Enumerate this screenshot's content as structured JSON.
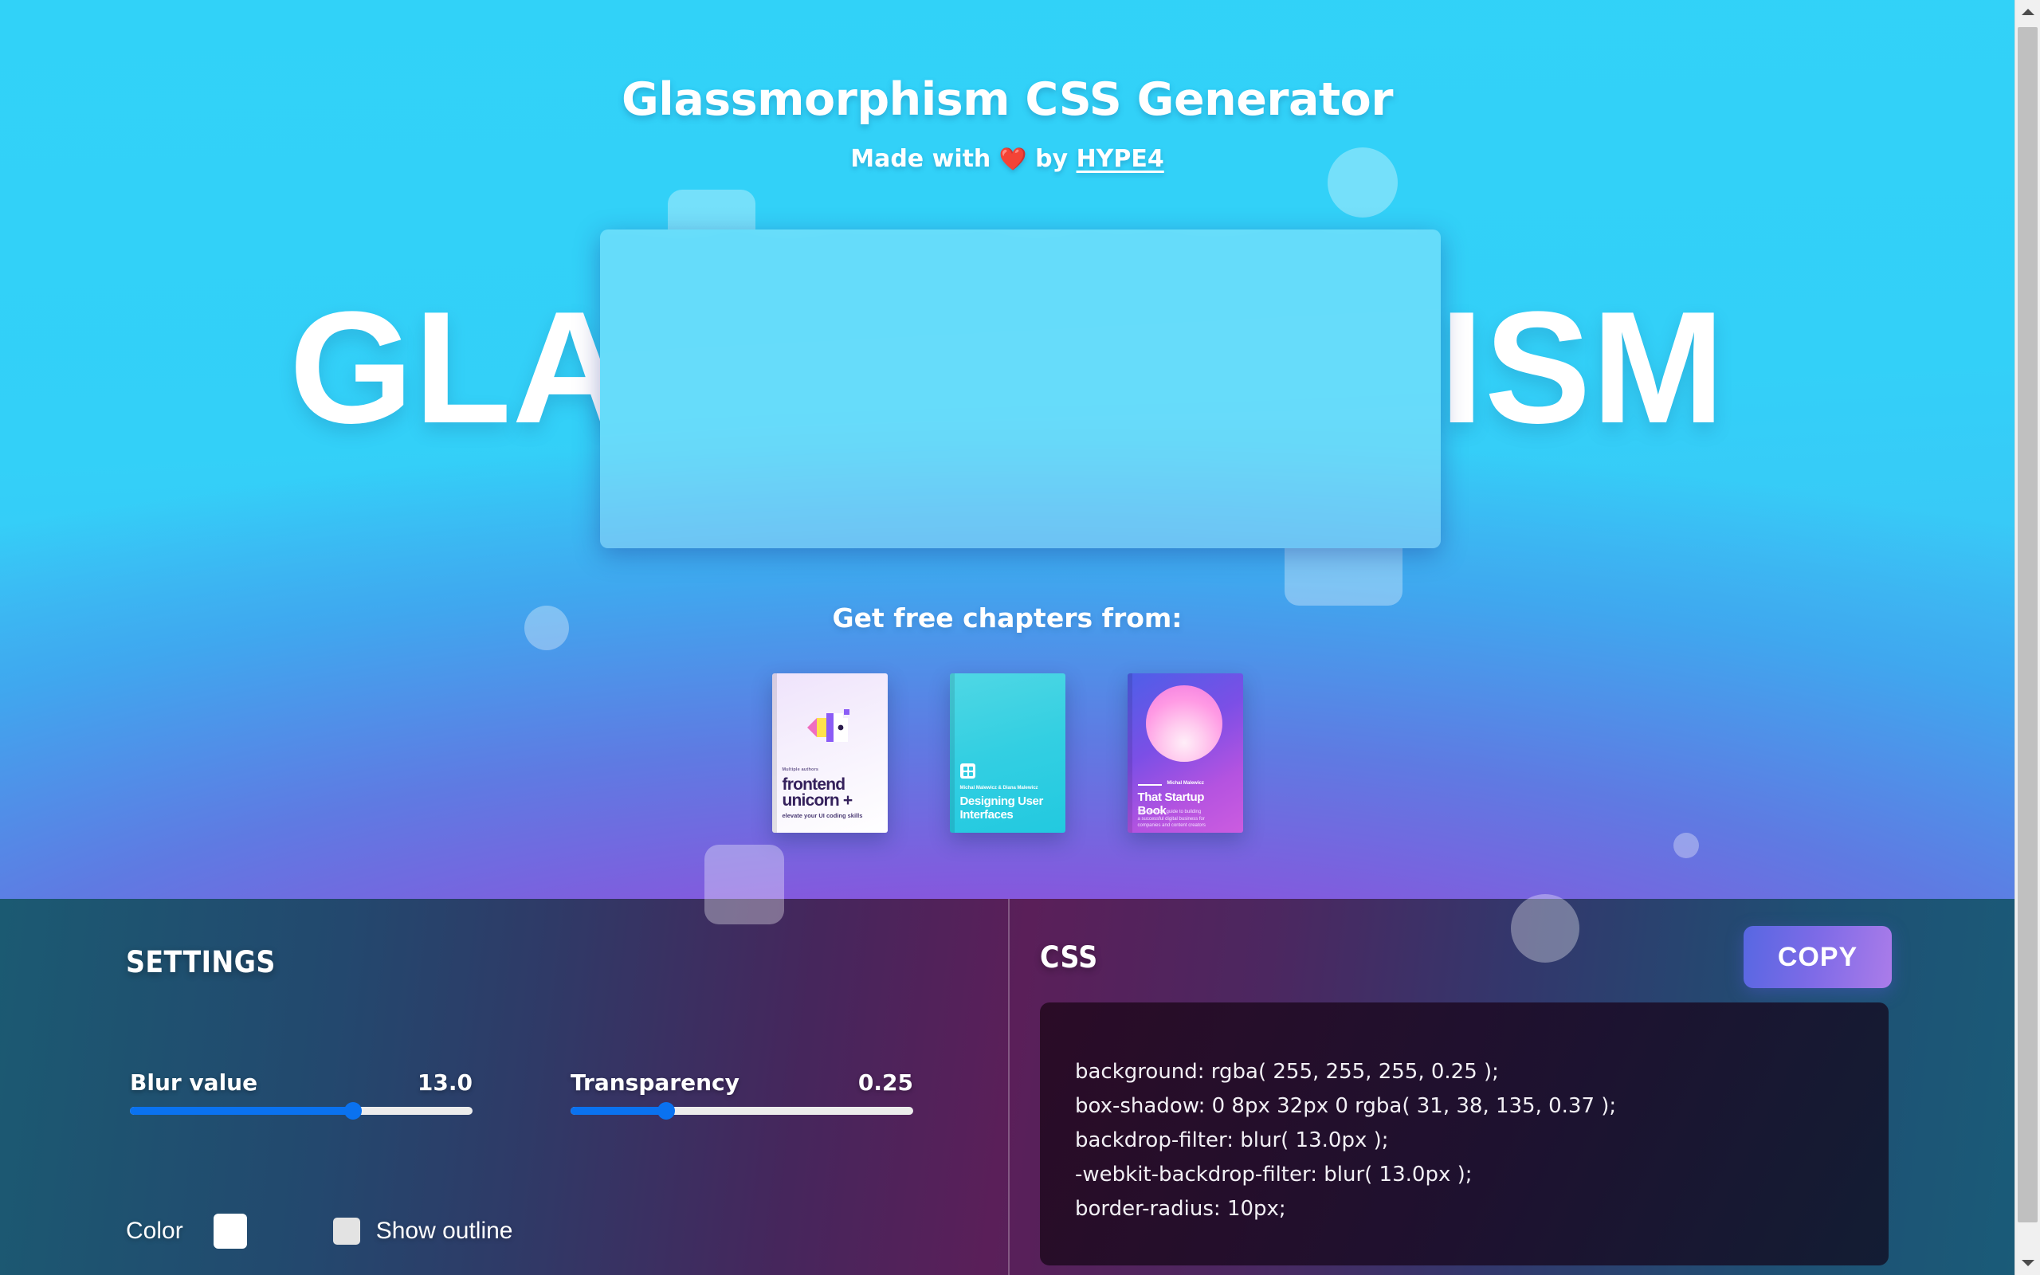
{
  "hero": {
    "title": "Glassmorphism CSS Generator",
    "made_with_prefix": "Made with",
    "heart_icon": "heart-icon",
    "by_text": "by",
    "brand_link": "HYPE4",
    "big_word": "GLASSMORPHISM",
    "chapters_title": "Get free chapters from:"
  },
  "books": [
    {
      "author": "Multiple authors",
      "title_line1": "frontend",
      "title_line2": "unicorn +",
      "tagline": "elevate your UI coding skills"
    },
    {
      "author": "Michal Malewicz & Diana Malewicz",
      "title_line1": "Designing User",
      "title_line2": "Interfaces"
    },
    {
      "author": "Michal Malewicz",
      "title": "That Startup Book",
      "blurb_line1": "The practical guide to building",
      "blurb_line2": "a successful digital business for",
      "blurb_line3": "companies and content creators"
    }
  ],
  "settings": {
    "heading": "SETTINGS",
    "blur": {
      "label": "Blur value",
      "value": "13.0",
      "fill_percent": 65
    },
    "transparency": {
      "label": "Transparency",
      "value": "0.25",
      "fill_percent": 28
    },
    "color": {
      "label": "Color",
      "swatch_hex": "#ffffff"
    },
    "outline": {
      "label": "Show outline",
      "checked": false
    }
  },
  "css_panel": {
    "heading": "CSS",
    "copy_label": "COPY",
    "lines": [
      "background: rgba( 255, 255, 255, 0.25 );",
      "box-shadow: 0 8px 32px 0 rgba( 31, 38, 135, 0.37 );",
      "backdrop-filter: blur( 13.0px );",
      "-webkit-backdrop-filter: blur( 13.0px );",
      "border-radius: 10px;"
    ]
  },
  "colors": {
    "hero_top": "#31d2f8",
    "hero_purple": "#a24fd0",
    "slider_accent": "#0a72f0",
    "copy_gradient_start": "#5767e2",
    "copy_gradient_end": "#ab7ce9",
    "heart": "#ff3b30"
  }
}
